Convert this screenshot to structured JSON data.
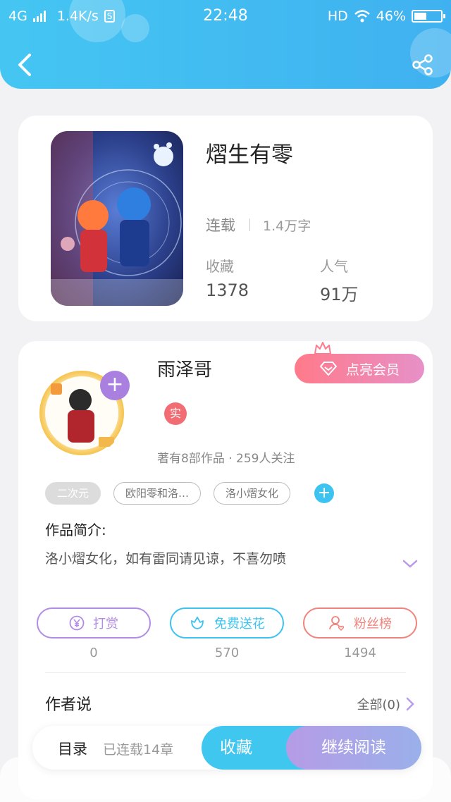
{
  "status_bar": {
    "network": "4G",
    "speed": "1.4K/s",
    "time": "22:48",
    "hd": "HD",
    "battery": "46%",
    "battery_level": 0.46
  },
  "header": {
    "back_icon": "chevron-left-icon",
    "share_icon": "share-icon"
  },
  "book": {
    "title": "熠生有零",
    "status": "连载",
    "word_count": "1.4万字",
    "favorites_label": "收藏",
    "favorites_value": "1378",
    "popularity_label": "人气",
    "popularity_value": "91万"
  },
  "author": {
    "name": "雨泽哥",
    "verified_badge": "实",
    "stats": "著有8部作品 · 259人关注",
    "vip_button": "点亮会员"
  },
  "tags": [
    "二次元",
    "欧阳零和洛…",
    "洛小熠女化"
  ],
  "intro": {
    "title": "作品简介:",
    "text": "洛小熠女化，如有雷同请见谅，不喜勿喷"
  },
  "actions": [
    {
      "label": "打赏",
      "count": "0",
      "icon": "yuan-coin-icon",
      "color": "#b28be6"
    },
    {
      "label": "免费送花",
      "count": "570",
      "icon": "flower-icon",
      "color": "#3cc3ef"
    },
    {
      "label": "粉丝榜",
      "count": "1494",
      "icon": "fan-icon",
      "color": "#f0837c"
    }
  ],
  "author_says": {
    "title": "作者说",
    "all_link": "全部(0)"
  },
  "bottom_bar": {
    "toc": "目录",
    "chapters": "已连载14章",
    "favorite_button": "收藏",
    "continue_button": "继续阅读"
  }
}
